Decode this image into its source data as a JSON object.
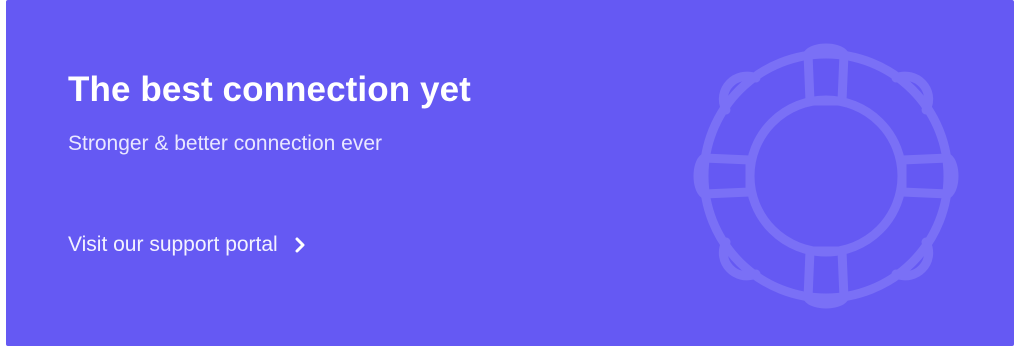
{
  "banner": {
    "title": "The best connection yet",
    "subtitle": "Stronger & better connection ever",
    "link_label": "Visit our support portal",
    "background_color": "#6559f3",
    "decoration_icon": "lifebuoy-icon",
    "link_icon": "chevron-right-icon"
  }
}
